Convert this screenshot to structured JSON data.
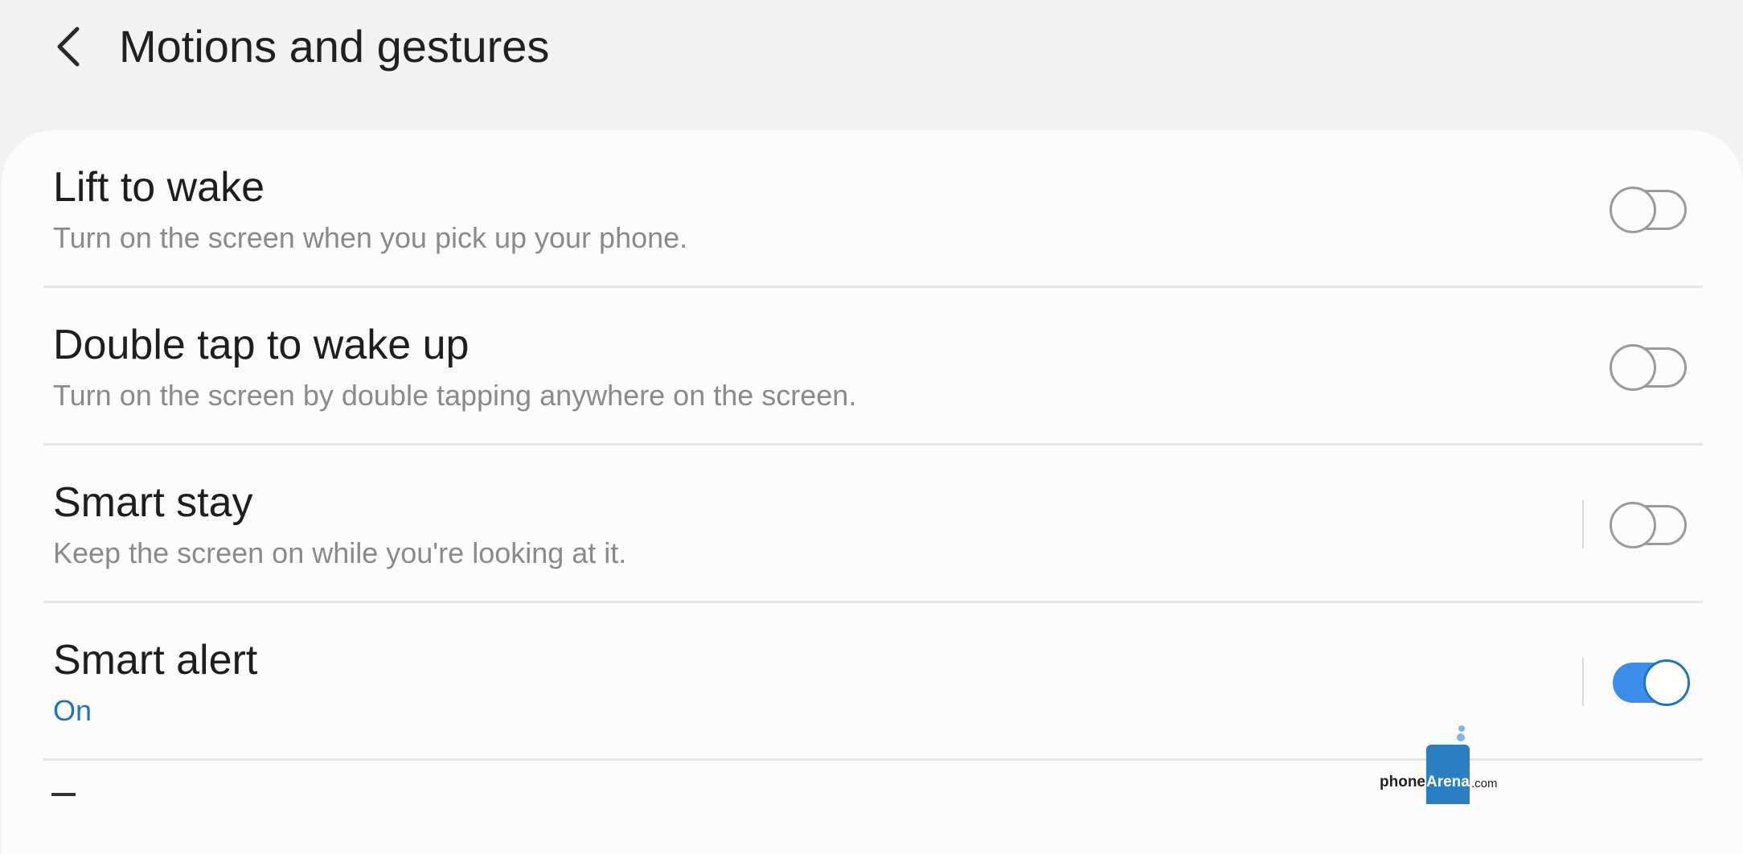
{
  "header": {
    "title": "Motions and gestures",
    "back_icon": "chevron-left-icon"
  },
  "settings": [
    {
      "title": "Lift to wake",
      "subtitle": "Turn on the screen when you pick up your phone.",
      "enabled": false
    },
    {
      "title": "Double tap to wake up",
      "subtitle": "Turn on the screen by double tapping anywhere on the screen.",
      "enabled": false
    },
    {
      "title": "Smart stay",
      "subtitle": "Keep the screen on while you're looking at it.",
      "enabled": false
    },
    {
      "title": "Smart alert",
      "subtitle": "On",
      "enabled": true
    }
  ],
  "watermark": {
    "brand_left": "phone",
    "brand_right": "Arena",
    "suffix": ".com"
  },
  "colors": {
    "background": "#f2f2f2",
    "card": "#fcfcfc",
    "accent": "#3d8eea",
    "on_text": "#1f74c9"
  }
}
